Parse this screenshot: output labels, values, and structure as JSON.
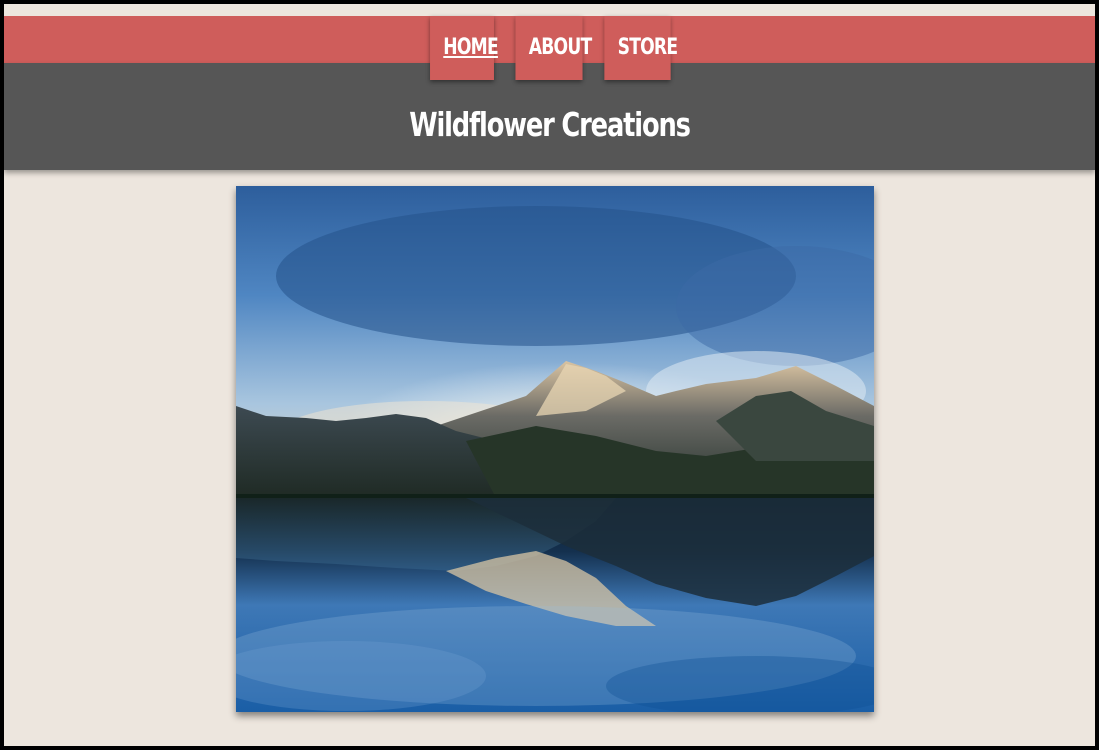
{
  "nav": {
    "items": [
      {
        "label": "HOME",
        "active": true
      },
      {
        "label": "ABOUT",
        "active": false
      },
      {
        "label": "STORE",
        "active": false
      }
    ]
  },
  "site": {
    "title": "Wildflower Creations"
  },
  "colors": {
    "accent": "#cf5d5b",
    "header_bg": "#565656",
    "page_bg": "#ede6de",
    "frame": "#000000"
  }
}
